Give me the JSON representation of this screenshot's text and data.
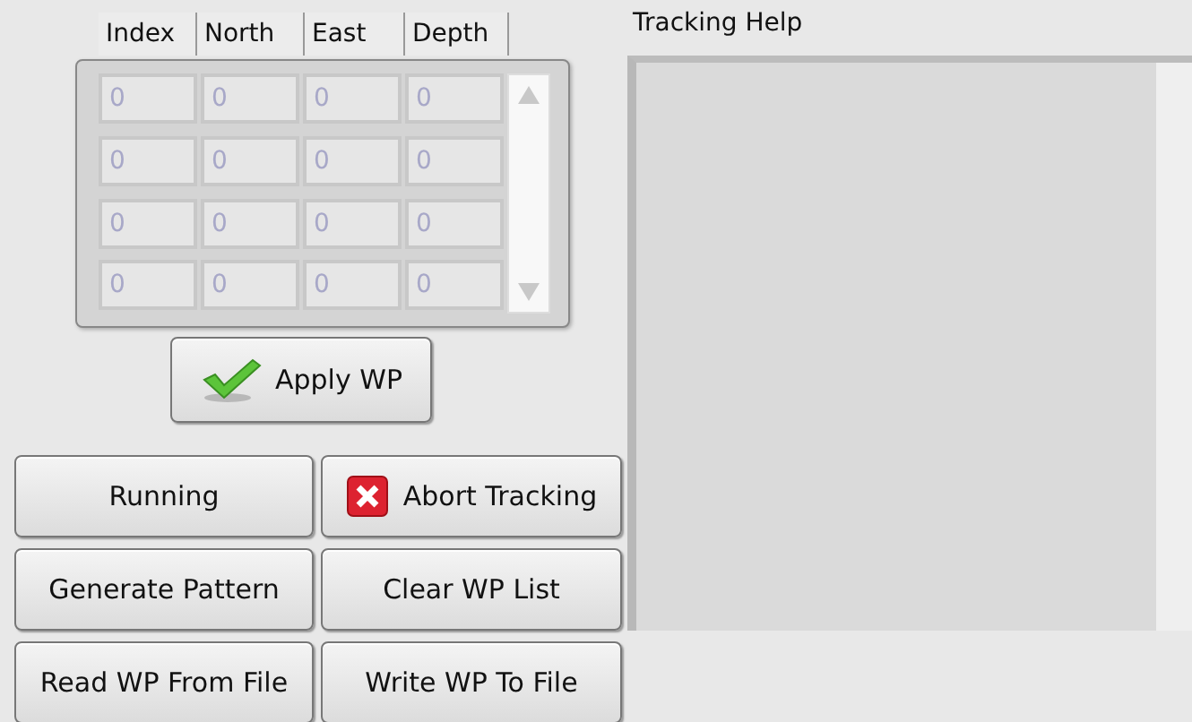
{
  "waypoint_table": {
    "columns": [
      "Index",
      "North",
      "East",
      "Depth"
    ],
    "rows": [
      [
        "0",
        "0",
        "0",
        "0"
      ],
      [
        "0",
        "0",
        "0",
        "0"
      ],
      [
        "0",
        "0",
        "0",
        "0"
      ],
      [
        "0",
        "0",
        "0",
        "0"
      ]
    ]
  },
  "apply_button": {
    "label": "Apply WP"
  },
  "buttons": [
    {
      "label": "Running",
      "kind": "plain"
    },
    {
      "label": "Abort Tracking",
      "kind": "abort"
    },
    {
      "label": "Generate Pattern",
      "kind": "plain"
    },
    {
      "label": "Clear WP List",
      "kind": "plain"
    },
    {
      "label": "Read WP From File",
      "kind": "plain"
    },
    {
      "label": "Write WP To File",
      "kind": "plain"
    }
  ],
  "help_panel": {
    "title": "Tracking Help"
  }
}
